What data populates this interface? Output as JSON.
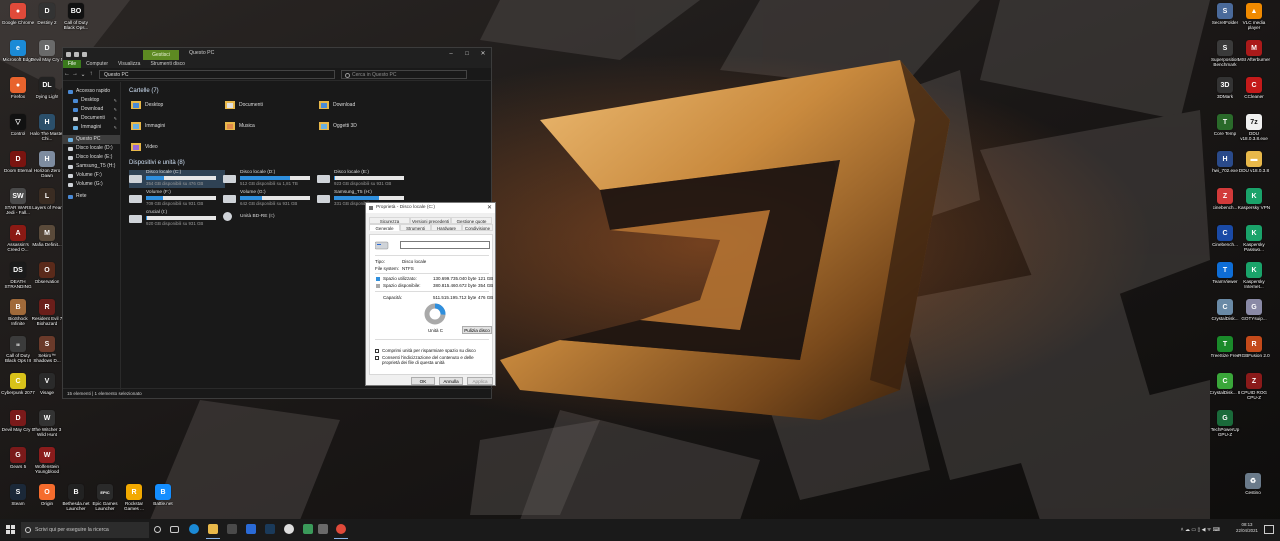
{
  "colors": {
    "accent": "#2f8fdd",
    "ribbon_green": "#5d8a22",
    "wallpaper_gold": "#c98a3e"
  },
  "desktop_left": [
    {
      "label": "Google Chrome",
      "icon": "chrome-icon",
      "color": "#e04a3a",
      "glyph": "●"
    },
    {
      "label": "Destiny 2",
      "icon": "destiny-icon",
      "color": "#333",
      "glyph": "D"
    },
    {
      "label": "Call of Duty Black Ops...",
      "icon": "cod-icon",
      "color": "#111",
      "glyph": "BO"
    },
    {
      "label": "Microsoft Edge",
      "icon": "edge-icon",
      "color": "#1b8ad6",
      "glyph": "e"
    },
    {
      "label": "Devil May Cry 5",
      "icon": "dmc-icon",
      "color": "#6a6a6a",
      "glyph": "D"
    },
    {
      "label": "Firefox",
      "icon": "firefox-icon",
      "color": "#e8632d",
      "glyph": "●"
    },
    {
      "label": "Dying Light",
      "icon": "dyinglight-icon",
      "color": "#222",
      "glyph": "DL"
    },
    {
      "label": "Control",
      "icon": "control-icon",
      "color": "#111",
      "glyph": "▽"
    },
    {
      "label": "Halo The Master Chi...",
      "icon": "halo-icon",
      "color": "#2b4f6a",
      "glyph": "H"
    },
    {
      "label": "Doom Eternal",
      "icon": "doom-icon",
      "color": "#7a1410",
      "glyph": "D"
    },
    {
      "label": "Horizon Zero Dawn",
      "icon": "horizon-icon",
      "color": "#7e8ca0",
      "glyph": "H"
    },
    {
      "label": "STAR WARS Jedi - Fall...",
      "icon": "jedi-icon",
      "color": "#4a4a4a",
      "glyph": "SW"
    },
    {
      "label": "Layers of Fear",
      "icon": "layers-icon",
      "color": "#3a2c22",
      "glyph": "L"
    },
    {
      "label": "Assassin's Creed O...",
      "icon": "ac-icon",
      "color": "#8a1a14",
      "glyph": "A"
    },
    {
      "label": "Mafia Definit...",
      "icon": "mafia-icon",
      "color": "#5a4a3a",
      "glyph": "M"
    },
    {
      "label": "DEATH STRANDING",
      "icon": "deathstranding-icon",
      "color": "#1a1a1a",
      "glyph": "DS"
    },
    {
      "label": "Observation",
      "icon": "observation-icon",
      "color": "#5a2a1a",
      "glyph": "O"
    },
    {
      "label": "BioShock Infinite",
      "icon": "bioshock-icon",
      "color": "#a06a3a",
      "glyph": "B"
    },
    {
      "label": "Resident Evil 7 Biohazard",
      "icon": "re7-icon",
      "color": "#6a1e1a",
      "glyph": "R"
    },
    {
      "label": "Call of Duty Black Ops III",
      "icon": "cod3-icon",
      "color": "#3b3b3b",
      "glyph": "III"
    },
    {
      "label": "Sekiro™ Shadows D...",
      "icon": "sekiro-icon",
      "color": "#6a3a2a",
      "glyph": "S"
    },
    {
      "label": "Cyberpunk 2077",
      "icon": "cyberpunk-icon",
      "color": "#d8c21a",
      "glyph": "C"
    },
    {
      "label": "Visage",
      "icon": "visage-icon",
      "color": "#2a2a2a",
      "glyph": "V"
    },
    {
      "label": "Devil May Cry 5",
      "icon": "dmc5-icon",
      "color": "#7a1a1a",
      "glyph": "D"
    },
    {
      "label": "The Witcher 3 Wild Hunt",
      "icon": "witcher-icon",
      "color": "#333",
      "glyph": "W"
    },
    {
      "label": "Gears 5",
      "icon": "gears-icon",
      "color": "#7a1a1a",
      "glyph": "G"
    },
    {
      "label": "Wolfenstein Youngblood",
      "icon": "wolfenstein-icon",
      "color": "#8a1c1c",
      "glyph": "W"
    },
    {
      "label": "Steam",
      "icon": "steam-icon",
      "color": "#1b2838",
      "glyph": "S"
    },
    {
      "label": "Origin",
      "icon": "origin-icon",
      "color": "#f56c2d",
      "glyph": "O"
    },
    {
      "label": "Bethesda.net Launcher",
      "icon": "bethesda-icon",
      "color": "#222",
      "glyph": "B"
    },
    {
      "label": "Epic Games Launcher",
      "icon": "epic-icon",
      "color": "#2a2a2a",
      "glyph": "EPIC"
    },
    {
      "label": "Rockstar Games ...",
      "icon": "rockstar-icon",
      "color": "#f2a900",
      "glyph": "R"
    },
    {
      "label": "Battle.net",
      "icon": "battlenet-icon",
      "color": "#148eff",
      "glyph": "B"
    }
  ],
  "desktop_right": [
    {
      "label": "SecretFolder",
      "icon": "folder-lock-icon",
      "color": "#4a6a9a",
      "glyph": "S"
    },
    {
      "label": "VLC media player",
      "icon": "vlc-icon",
      "color": "#f08a00",
      "glyph": "▲"
    },
    {
      "label": "Superposition Benchmark",
      "icon": "superposition-icon",
      "color": "#3a3a3a",
      "glyph": "S"
    },
    {
      "label": "MSI Afterburner",
      "icon": "afterburner-icon",
      "color": "#aa1a1a",
      "glyph": "M"
    },
    {
      "label": "3DMark",
      "icon": "3dmark-icon",
      "color": "#333",
      "glyph": "3D"
    },
    {
      "label": "CCleaner",
      "icon": "ccleaner-icon",
      "color": "#c41a1a",
      "glyph": "C"
    },
    {
      "label": "Core Temp",
      "icon": "coretemp-icon",
      "color": "#2a6a2a",
      "glyph": "T"
    },
    {
      "label": "DDU v18.0.3.8.exe",
      "icon": "ddu-icon",
      "color": "#f0f0f0",
      "glyph": "7z"
    },
    {
      "label": "hwi_702.exe",
      "icon": "hwinfo-icon",
      "color": "#2a4a8a",
      "glyph": "H"
    },
    {
      "label": "DDU v18.0.3.8",
      "icon": "ddu-folder-icon",
      "color": "#e8b84a",
      "glyph": "▬"
    },
    {
      "label": "cinebench...",
      "icon": "cinebench-zip-icon",
      "color": "#d23a3a",
      "glyph": "Z"
    },
    {
      "label": "Kaspersky VPN",
      "icon": "kaspersky-vpn-icon",
      "color": "#1aa36a",
      "glyph": "K"
    },
    {
      "label": "Cinebench...",
      "icon": "cinebench-icon",
      "color": "#1a4aa6",
      "glyph": "C"
    },
    {
      "label": "Kaspersky Passwo...",
      "icon": "kaspersky-pw-icon",
      "color": "#1aa36a",
      "glyph": "K"
    },
    {
      "label": "TeamViewer",
      "icon": "teamviewer-icon",
      "color": "#0e6dd6",
      "glyph": "T"
    },
    {
      "label": "Kaspersky Internet...",
      "icon": "kaspersky-is-icon",
      "color": "#1aa36a",
      "glyph": "K"
    },
    {
      "label": "CrystalDisk...",
      "icon": "crystaldisk-icon",
      "color": "#6a8aa6",
      "glyph": "C"
    },
    {
      "label": "GOTYsuip...",
      "icon": "goty-icon",
      "color": "#8a8aa6",
      "glyph": "G"
    },
    {
      "label": "TreeSize Free",
      "icon": "treesize-icon",
      "color": "#1a8a2a",
      "glyph": "T"
    },
    {
      "label": "RGBFusion 2.0",
      "icon": "rgbfusion-icon",
      "color": "#c44a1a",
      "glyph": "R"
    },
    {
      "label": "CrystalDisk... 8",
      "icon": "crystaldisk8-icon",
      "color": "#3aa63a",
      "glyph": "C"
    },
    {
      "label": "CPUID ROG CPU-Z",
      "icon": "cpuz-icon",
      "color": "#8a1a1a",
      "glyph": "Z"
    },
    {
      "label": "TechPowerUp GPU-Z",
      "icon": "gpuz-icon",
      "color": "#1a6a3a",
      "glyph": "G"
    },
    {
      "label": "Cestino",
      "icon": "recycle-bin-icon",
      "color": "#6a7a8a",
      "glyph": "♻"
    }
  ],
  "explorer": {
    "ribbon_context_tab": "Gestisci",
    "title": "Questo PC",
    "menu": [
      "File",
      "Computer",
      "Visualizza",
      "Strumenti disco"
    ],
    "address": "Questo PC",
    "search_placeholder": "Cerca in Questo PC",
    "nav": [
      {
        "label": "Accesso rapido",
        "color": "#4a8ad6",
        "pinned": false,
        "selected": false
      },
      {
        "label": "Desktop",
        "color": "#4a8ad6",
        "pinned": true,
        "selected": false
      },
      {
        "label": "Download",
        "color": "#4a8ad6",
        "pinned": true,
        "selected": false
      },
      {
        "label": "Documenti",
        "color": "#cfcfcf",
        "pinned": true,
        "selected": false
      },
      {
        "label": "Immagini",
        "color": "#6ab0e0",
        "pinned": true,
        "selected": false
      },
      {
        "label": "Questo PC",
        "color": "#6ab0e0",
        "pinned": false,
        "selected": true
      },
      {
        "label": "Disco locale (D:)",
        "color": "#cfd3d8",
        "pinned": false,
        "selected": false
      },
      {
        "label": "Disco locale (E:)",
        "color": "#cfd3d8",
        "pinned": false,
        "selected": false
      },
      {
        "label": "Samsung_T5 (H:)",
        "color": "#cfd3d8",
        "pinned": false,
        "selected": false
      },
      {
        "label": "Volume (F:)",
        "color": "#cfd3d8",
        "pinned": false,
        "selected": false
      },
      {
        "label": "Volume (G:)",
        "color": "#cfd3d8",
        "pinned": false,
        "selected": false
      },
      {
        "label": "Rete",
        "color": "#4a8ad6",
        "pinned": false,
        "selected": false
      }
    ],
    "folders_header": "Cartelle (7)",
    "folders": [
      {
        "label": "Desktop",
        "accent": "#4a8ad6"
      },
      {
        "label": "Documenti",
        "accent": "#e0e0e0"
      },
      {
        "label": "Download",
        "accent": "#4a8ad6"
      },
      {
        "label": "Immagini",
        "accent": "#6ab0e0"
      },
      {
        "label": "Musica",
        "accent": "#e08a4a"
      },
      {
        "label": "Oggetti 3D",
        "accent": "#6ab0e0"
      },
      {
        "label": "Video",
        "accent": "#9a6ad6"
      }
    ],
    "drives_header": "Dispositivi e unità (8)",
    "drives": [
      {
        "name": "Disco locale (C:)",
        "free": "354 GB disponibili su 476 GB",
        "used_fraction": 0.26,
        "selected": true
      },
      {
        "name": "Disco locale (D:)",
        "free": "512 GB disponibili su 1,81 TB",
        "used_fraction": 0.72,
        "selected": false
      },
      {
        "name": "Disco locale (E:)",
        "free": "923 GB disponibili su 931 GB",
        "used_fraction": 0.01,
        "selected": false
      },
      {
        "name": "Volume (F:)",
        "free": "709 GB disponibili su 931 GB",
        "used_fraction": 0.24,
        "selected": false
      },
      {
        "name": "Volume (G:)",
        "free": "642 GB disponibili su 931 GB",
        "used_fraction": 0.31,
        "selected": false
      },
      {
        "name": "Samsung_T5 (H:)",
        "free": "331 GB disponibili su 931 GB",
        "used_fraction": 0.64,
        "selected": false
      },
      {
        "name": "crucial (I:)",
        "free": "920 GB disponibili su 931 GB",
        "used_fraction": 0.01,
        "selected": false
      },
      {
        "name": "Unità BD-RE (I:)",
        "free": "",
        "used_fraction": null,
        "selected": false
      }
    ],
    "status": "15 elementi  |  1 elemento selezionato"
  },
  "props": {
    "title": "Proprietà - Disco locale (C:)",
    "tabs_row1": [
      "Sicurezza",
      "Versioni precedenti",
      "Gestione quote"
    ],
    "tabs_row2": [
      "Generale",
      "Strumenti",
      "Hardware",
      "Condivisione"
    ],
    "name_value": "",
    "type_label": "Tipo:",
    "type_value": "Disco locale",
    "fs_label": "File system:",
    "fs_value": "NTFS",
    "used_label": "Spazio utilizzato:",
    "used_bytes": "130.699.735.040 byte",
    "used_gb": "121 GB",
    "free_label": "Spazio disponibile:",
    "free_bytes": "380.815.460.672 byte",
    "free_gb": "354 GB",
    "cap_label": "Capacità:",
    "cap_bytes": "511.515.195.712 byte",
    "cap_gb": "476 GB",
    "used_fraction": 0.26,
    "unit_label": "Unità C",
    "cleanup_button": "Pulizia disco",
    "check1": "Comprimi unità per risparmiare spazio su disco",
    "check2": "Consenti l'indicizzazione del contenuto e delle proprietà dei file di questa unità",
    "ok": "OK",
    "cancel": "Annulla",
    "apply": "Applica"
  },
  "taskbar": {
    "search_placeholder": "Scrivi qui per eseguire la ricerca",
    "time": "08:13",
    "date": "22/04/2021"
  }
}
